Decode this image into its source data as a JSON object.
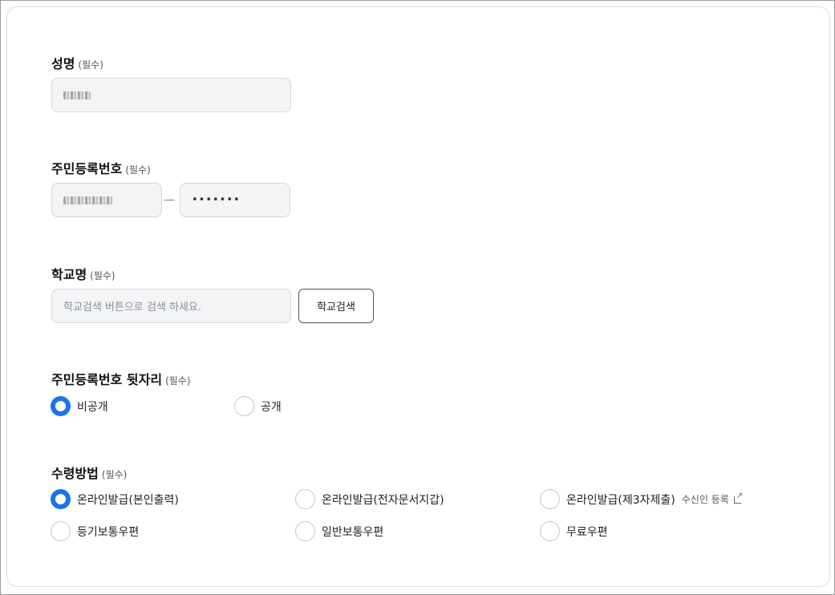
{
  "name": {
    "label": "성명",
    "required": "(필수)"
  },
  "rrn": {
    "label": "주민등록번호",
    "required": "(필수)",
    "back_value": "•••••••"
  },
  "school": {
    "label": "학교명",
    "required": "(필수)",
    "placeholder": "학교검색 버튼으로 검색 하세요.",
    "search_button": "학교검색"
  },
  "rrn_back_visibility": {
    "label": "주민등록번호 뒷자리",
    "required": "(필수)",
    "options": [
      {
        "label": "비공개",
        "checked": true
      },
      {
        "label": "공개",
        "checked": false
      }
    ]
  },
  "receive_method": {
    "label": "수령방법",
    "required": "(필수)",
    "options": [
      {
        "label": "온라인발급(본인출력)",
        "checked": true
      },
      {
        "label": "온라인발급(전자문서지갑)",
        "checked": false
      },
      {
        "label": "온라인발급(제3자제출)",
        "checked": false,
        "extra": "수신인 등록"
      },
      {
        "label": "등기보통우편",
        "checked": false
      },
      {
        "label": "일반보통우편",
        "checked": false
      },
      {
        "label": "무료우편",
        "checked": false
      }
    ]
  },
  "colors": {
    "accent": "#1a73e8",
    "field_bg": "#f3f4f6"
  }
}
